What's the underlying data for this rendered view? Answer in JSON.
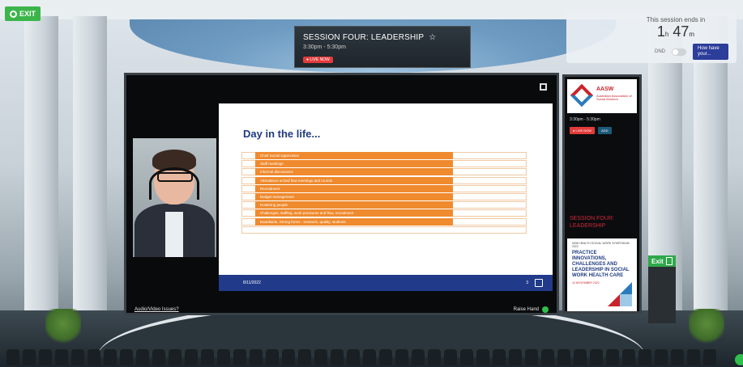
{
  "exit_button": {
    "label": "EXIT"
  },
  "session_banner": {
    "title": "SESSION FOUR: LEADERSHIP",
    "star_icon": "star-icon",
    "time": "3:30pm - 5:30pm",
    "live_label": "● LIVE NOW"
  },
  "timer": {
    "label": "This session ends in",
    "hours": "1",
    "hours_unit": "h",
    "minutes": "47",
    "minutes_unit": "m",
    "dnd_label": "DND",
    "guide_button": "How have your... "
  },
  "slide": {
    "title": "Day in the life...",
    "rows": [
      "Chief Social supervision",
      "Staff meetings",
      "Informal discussions",
      "Attendance at bed flow meetings and rounds",
      "Recruitment",
      "Budget management",
      "Rostering people",
      "Challenges, staffing, work pressures and flow, recruitment",
      "Boardwide, Strong forms - research, quality, students",
      ""
    ],
    "footer_date": "8/11/2022",
    "page_number": "3"
  },
  "screen_controls": {
    "av_issues_link": "Audio/Video Issues?",
    "raise_hand": "Raise Hand"
  },
  "side_panel": {
    "org_name": "AASW",
    "org_subtitle": "Australian Association of Social Workers",
    "time": "3:30pm - 5:30pm",
    "live_label": "● LIVE NOW",
    "add_label": "ADD",
    "session_name": "SESSION FOUR: LEADERSHIP",
    "poster": {
      "small": "NSW HEALTH SOCIAL WORK SYMPOSIUM 2022",
      "big": "PRACTICE INNOVATIONS, CHALLENGES AND LEADERSHIP IN SOCIAL WORK HEALTH CARE",
      "date": "10 NOVEMBER 2022"
    }
  },
  "exit_sign": {
    "label": "Exit"
  }
}
